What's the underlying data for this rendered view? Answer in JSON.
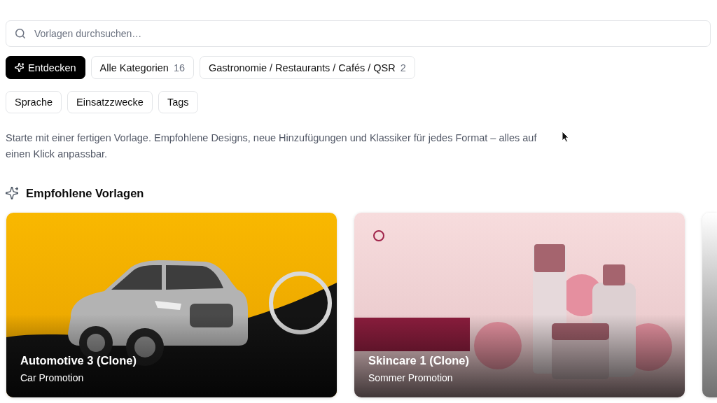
{
  "search": {
    "placeholder": "Vorlagen durchsuchen…"
  },
  "tabs": [
    {
      "kind": "discover",
      "label": "Entdecken",
      "selected": true
    },
    {
      "kind": "category",
      "label": "Alle Kategorien",
      "count": "16",
      "selected": false
    },
    {
      "kind": "category",
      "label": "Gastronomie / Restaurants / Cafés / QSR",
      "count": "2",
      "selected": false
    }
  ],
  "filters": [
    "Sprache",
    "Einsatzzwecke",
    "Tags"
  ],
  "intro": "Starte mit einer fertigen Vorlage. Empfohlene Designs, neue Hinzufügungen und Klassiker für jedes Format – alles auf einen Klick anpassbar.",
  "featured": {
    "heading": "Empfohlene Vorlagen",
    "templates": [
      {
        "kind": "automotive",
        "title": "Automotive 3 (Clone)",
        "subtitle": "Car Promotion"
      },
      {
        "kind": "beauty",
        "title": "Skincare 1 (Clone)",
        "subtitle": "Sommer Promotion"
      },
      {
        "kind": "plain"
      }
    ]
  }
}
